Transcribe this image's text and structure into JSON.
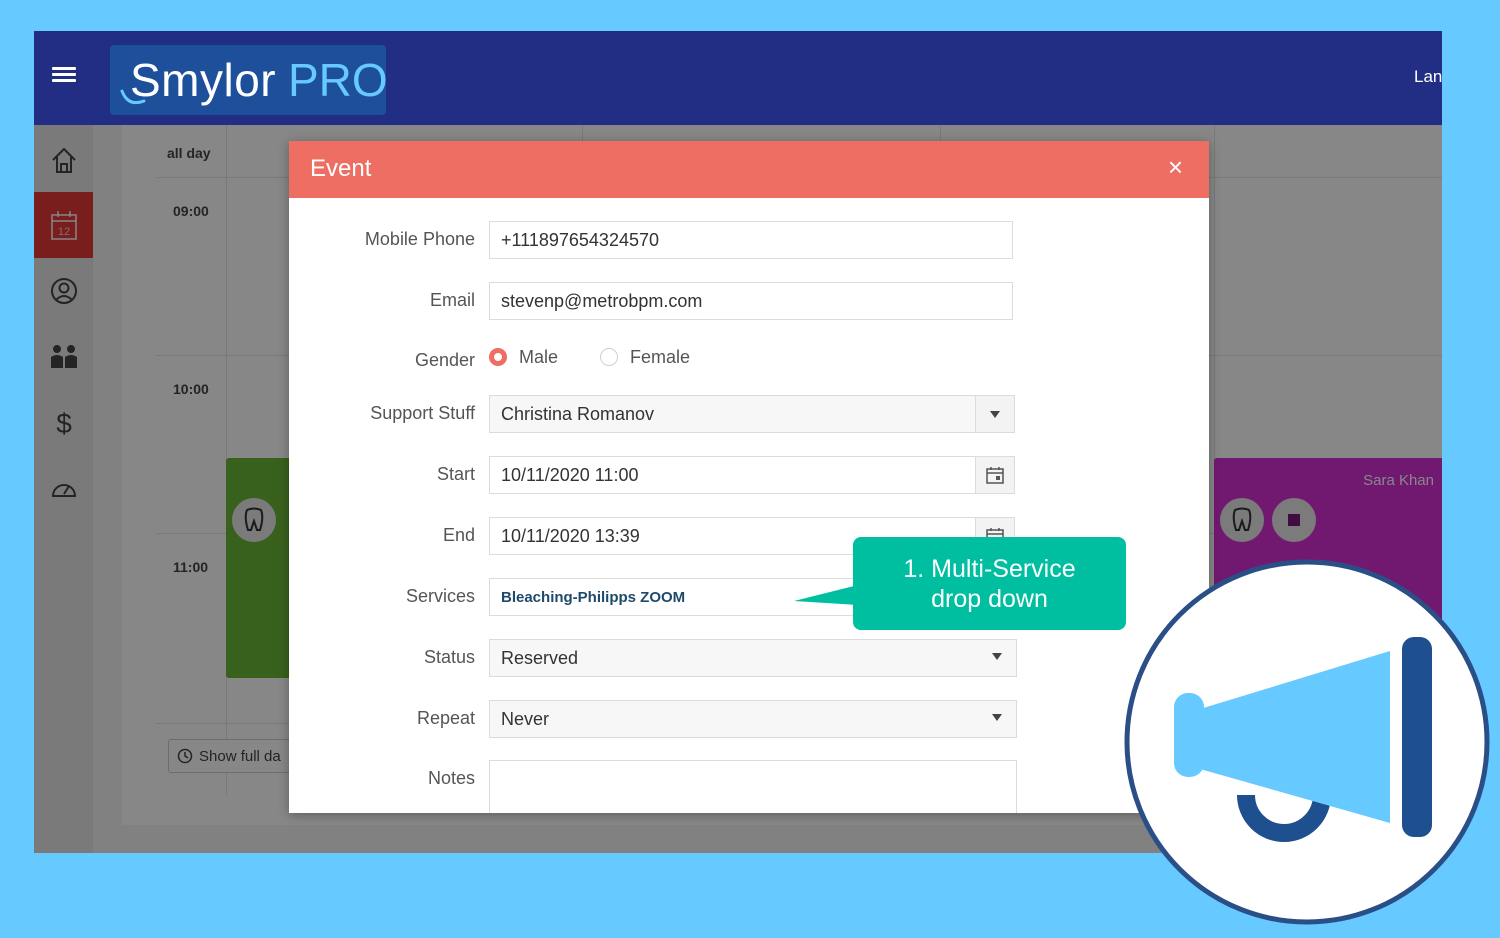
{
  "header": {
    "logo_main": "Smylor",
    "logo_accent": "PRO",
    "language_label": "Lan"
  },
  "sidebar": {
    "items": [
      {
        "icon": "home-icon"
      },
      {
        "icon": "calendar-icon",
        "badge": "12",
        "active": true
      },
      {
        "icon": "user-circle-icon"
      },
      {
        "icon": "people-icon"
      },
      {
        "icon": "dollar-icon"
      },
      {
        "icon": "dashboard-icon"
      }
    ]
  },
  "calendar": {
    "all_day_label": "all day",
    "times": [
      "09:00",
      "10:00",
      "11:00"
    ],
    "event_right_name": "Sara Khan",
    "show_full_day_label": "Show full da"
  },
  "modal": {
    "title": "Event",
    "close_symbol": "×",
    "fields": {
      "mobile_phone": {
        "label": "Mobile Phone",
        "value": "+111897654324570"
      },
      "email": {
        "label": "Email",
        "value": "stevenp@metrobpm.com"
      },
      "gender": {
        "label": "Gender",
        "options": [
          "Male",
          "Female"
        ],
        "selected": "Male"
      },
      "support_stuff": {
        "label": "Support Stuff",
        "value": "Christina Romanov"
      },
      "start": {
        "label": "Start",
        "value": "10/11/2020 11:00"
      },
      "end": {
        "label": "End",
        "value": "10/11/2020 13:39"
      },
      "services": {
        "label": "Services",
        "value": "Bleaching-Philipps ZOOM"
      },
      "status": {
        "label": "Status",
        "value": "Reserved"
      },
      "repeat": {
        "label": "Repeat",
        "value": "Never"
      },
      "notes": {
        "label": "Notes",
        "value": ""
      }
    }
  },
  "callout": {
    "line1": "1. Multi-Service",
    "line2": "drop down"
  },
  "colors": {
    "background": "#66c9ff",
    "topbar": "#222d84",
    "modal_header": "#ee6e63",
    "callout": "#00bfa0",
    "badge_dark": "#1e4f8f"
  }
}
